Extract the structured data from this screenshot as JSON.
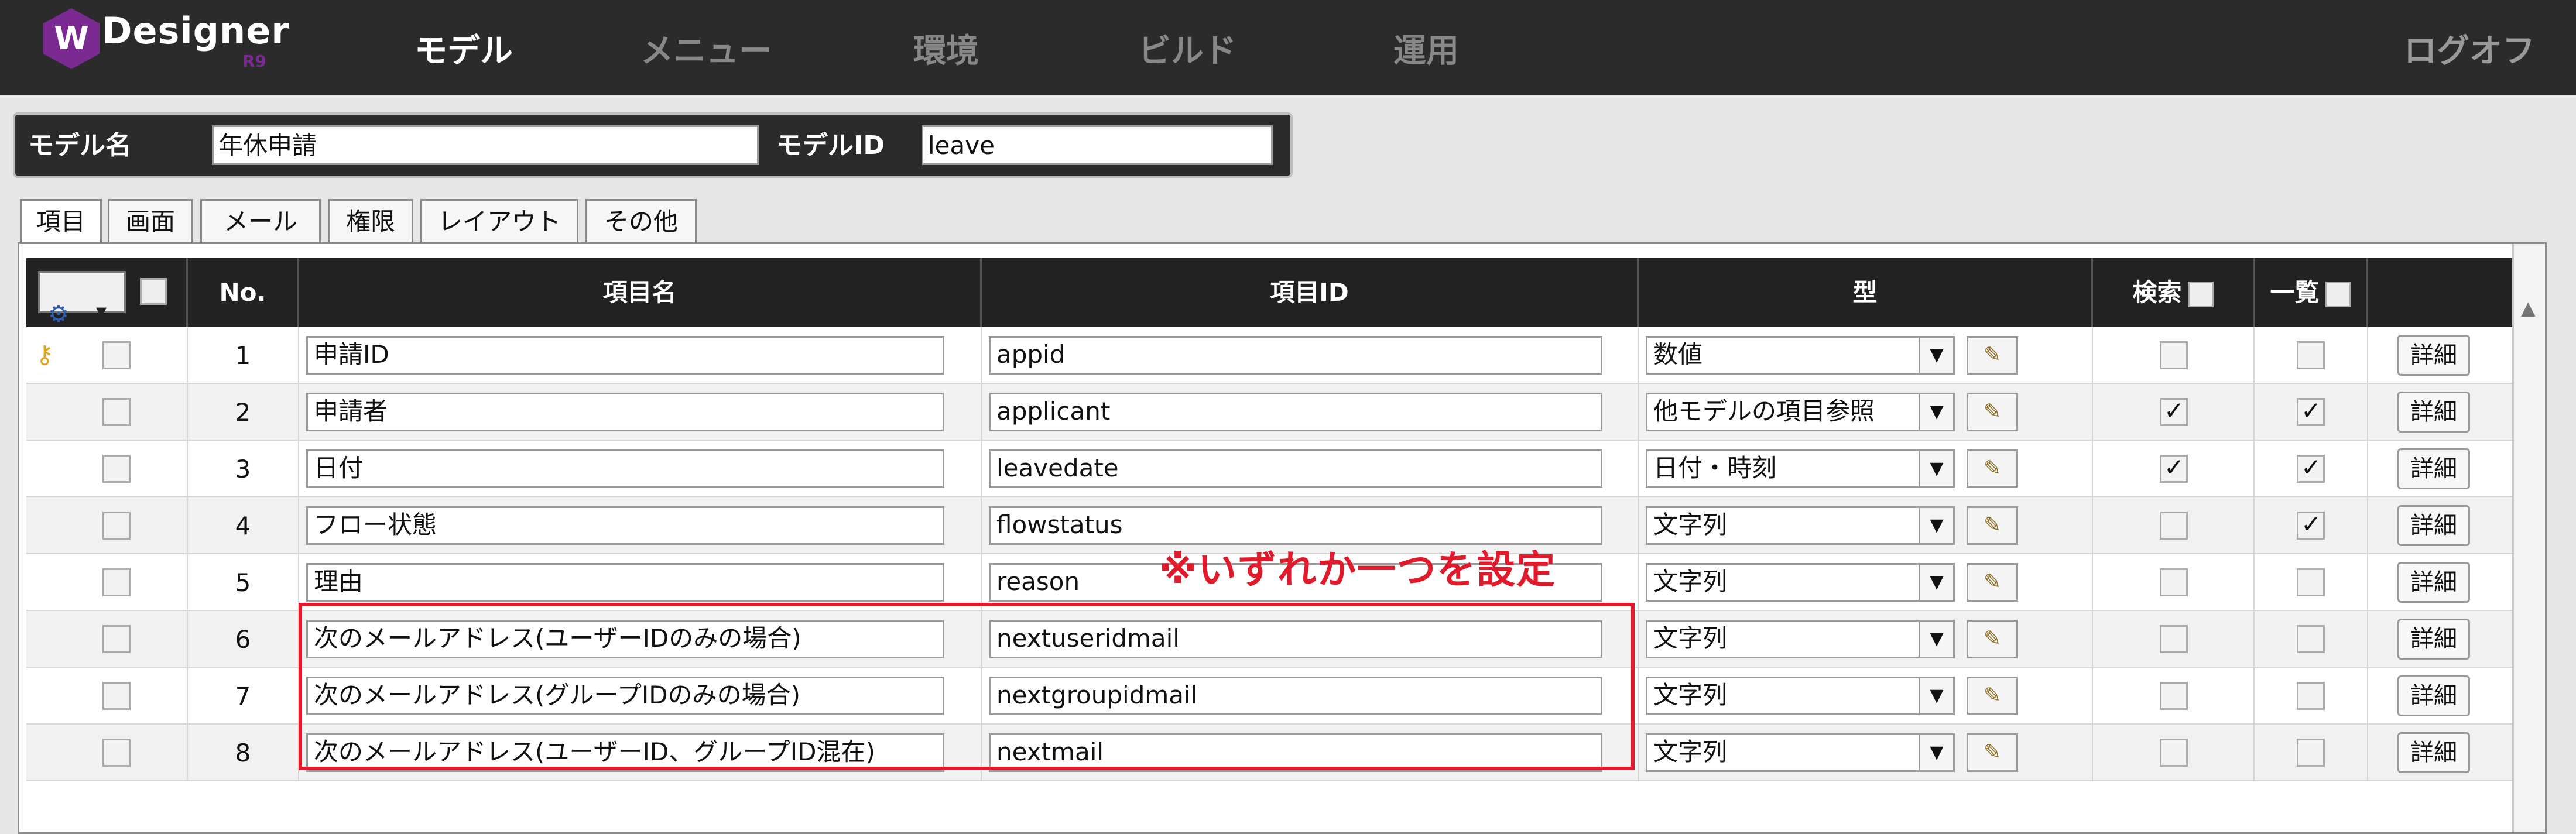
{
  "app": {
    "logo_text": "Designer",
    "version": "R9"
  },
  "nav": {
    "items": [
      "モデル",
      "メニュー",
      "環境",
      "ビルド",
      "運用"
    ],
    "logout": "ログオフ"
  },
  "model": {
    "name_label": "モデル名",
    "name_value": "年休申請",
    "id_label": "モデルID",
    "id_value": "leave"
  },
  "tabs": [
    "項目",
    "画面",
    "メール",
    "権限",
    "レイアウト",
    "その他"
  ],
  "grid": {
    "headers": {
      "no": "No.",
      "item_name": "項目名",
      "item_id": "項目ID",
      "type": "型",
      "search": "検索",
      "list": "一覧"
    },
    "detail_label": "詳細",
    "rows": [
      {
        "no": "1",
        "name": "申請ID",
        "id": "appid",
        "type": "数値",
        "search": false,
        "list": false,
        "key": true
      },
      {
        "no": "2",
        "name": "申請者",
        "id": "applicant",
        "type": "他モデルの項目参照",
        "search": true,
        "list": true,
        "key": false
      },
      {
        "no": "3",
        "name": "日付",
        "id": "leavedate",
        "type": "日付・時刻",
        "search": true,
        "list": true,
        "key": false
      },
      {
        "no": "4",
        "name": "フロー状態",
        "id": "flowstatus",
        "type": "文字列",
        "search": false,
        "list": true,
        "key": false
      },
      {
        "no": "5",
        "name": "理由",
        "id": "reason",
        "type": "文字列",
        "search": false,
        "list": false,
        "key": false
      },
      {
        "no": "6",
        "name": "次のメールアドレス(ユーザーIDのみの場合)",
        "id": "nextuseridmail",
        "type": "文字列",
        "search": false,
        "list": false,
        "key": false
      },
      {
        "no": "7",
        "name": "次のメールアドレス(グループIDのみの場合)",
        "id": "nextgroupidmail",
        "type": "文字列",
        "search": false,
        "list": false,
        "key": false
      },
      {
        "no": "8",
        "name": "次のメールアドレス(ユーザーID、グループID混在)",
        "id": "nextmail",
        "type": "文字列",
        "search": false,
        "list": false,
        "key": false
      }
    ]
  },
  "annotation": {
    "note": "※いずれか一つを設定",
    "color": "#e0192b"
  },
  "colors": {
    "topbar": "#2b2b2b",
    "brand": "#7a2a91"
  }
}
